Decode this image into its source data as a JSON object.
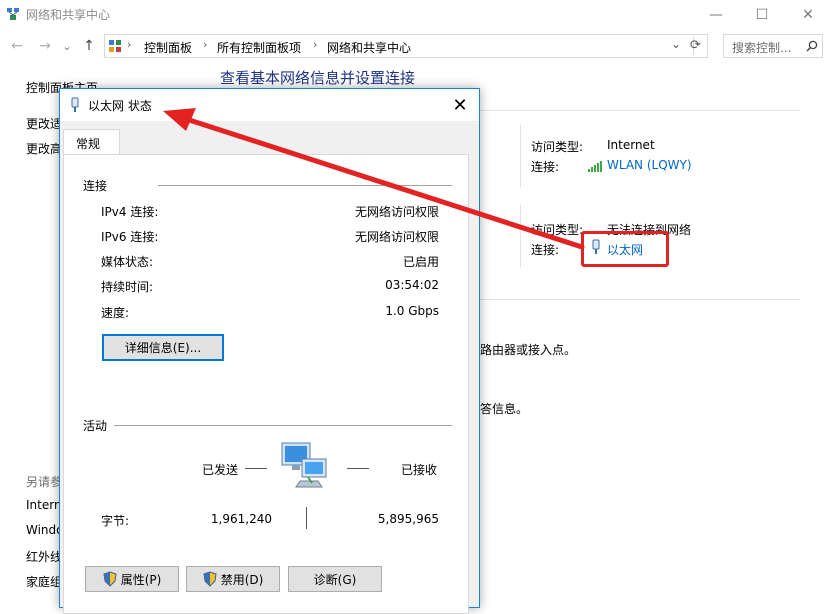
{
  "window": {
    "title": "网络和共享中心",
    "controls": {
      "minimize": "—",
      "maximize": "☐",
      "close": "✕"
    }
  },
  "nav": {
    "back": "←",
    "forward": "→",
    "recent": "⌄",
    "up": "↑",
    "breadcrumbs": [
      "控制面板",
      "所有控制面板项",
      "网络和共享中心"
    ],
    "dropdown": "⌄",
    "refresh": "⟳",
    "search_placeholder": "搜索控制..."
  },
  "sidebar": {
    "home": "控制面板主页",
    "item1": "更改适",
    "item2": "更改高",
    "see_also": "另请参",
    "links": [
      "Intern",
      "Windo",
      "红外线",
      "家庭组"
    ]
  },
  "main": {
    "heading": "查看基本网络信息并设置连接",
    "net1": {
      "access_label": "访问类型:",
      "access_value": "Internet",
      "conn_label": "连接:",
      "conn_value": "WLAN (LQWY)"
    },
    "net2": {
      "access_label": "访问类型:",
      "access_value": "无法连接到网络",
      "conn_label": "连接:",
      "conn_value": "以太网"
    },
    "frag1": "路由器或接入点。",
    "frag2": "答信息。"
  },
  "dialog": {
    "title": "以太网 状态",
    "close": "✕",
    "tab": "常规",
    "connection_group": "连接",
    "rows": [
      {
        "label": "IPv4 连接:",
        "value": "无网络访问权限"
      },
      {
        "label": "IPv6 连接:",
        "value": "无网络访问权限"
      },
      {
        "label": "媒体状态:",
        "value": "已启用"
      },
      {
        "label": "持续时间:",
        "value": "03:54:02"
      },
      {
        "label": "速度:",
        "value": "1.0 Gbps"
      }
    ],
    "details_button": "详细信息(E)...",
    "activity_group": "活动",
    "sent_label": "已发送",
    "received_label": "已接收",
    "bytes_label": "字节:",
    "bytes_sent": "1,961,240",
    "bytes_received": "5,895,965",
    "properties_button": "属性(P)",
    "disable_button": "禁用(D)",
    "diagnose_button": "诊断(G)"
  },
  "colors": {
    "accent": "#0078d7",
    "link": "#0066cc",
    "heading": "#1e3287",
    "annotation": "#e32222"
  }
}
